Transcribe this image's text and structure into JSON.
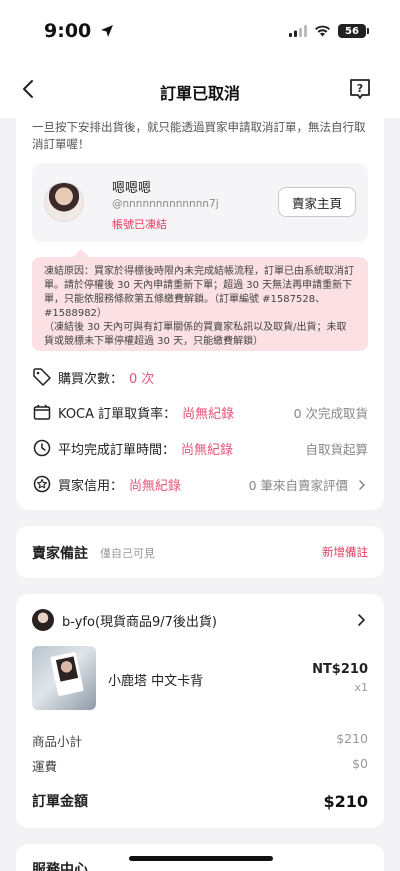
{
  "status_bar": {
    "time": "9:00",
    "battery": "56"
  },
  "nav": {
    "title": "訂單已取消"
  },
  "cancel_notice": "一旦按下安排出貨後，就只能透過買家申請取消訂單，無法自行取消訂單喔！",
  "seller": {
    "name": "嗯嗯嗯",
    "handle": "@nnnnnnnnnnnnn7j",
    "status": "帳號已凍結",
    "home_button": "賣家主頁"
  },
  "freeze_notice": {
    "line1": "凍結原因：買家於得標後時限內未完成結帳流程，訂單已由系統取消訂單。請於停權後 30 天內申請重新下單；超過 30 天無法再申請重新下單，只能依服務條款第五條繳費解鎖。（訂單編號 #1587528、#1588982）",
    "line2": "（凍結後 30 天內可與有訂單關係的買賣家私訊以及取貨/出貨；未取貨或競標未下單停權超過 30 天，只能繳費解鎖）"
  },
  "stats": [
    {
      "label": "購買次數：",
      "value": "0 次",
      "right": "",
      "icon": "tag-icon"
    },
    {
      "label": "KOCA 訂單取貨率：",
      "value": "尚無紀錄",
      "right": "0 次完成取貨",
      "icon": "box-icon"
    },
    {
      "label": "平均完成訂單時間：",
      "value": "尚無紀錄",
      "right": "自取貨起算",
      "icon": "clock-icon"
    },
    {
      "label": "買家信用：",
      "value": "尚無紀錄",
      "right": "0 筆來自賣家評價",
      "icon": "star-badge-icon"
    }
  ],
  "notes": {
    "title": "賣家備註",
    "subtitle": "僅自己可見",
    "add": "新增備註"
  },
  "order": {
    "shop_name": "b-yfo(現貨商品9/7後出貨)",
    "product_name": "小鹿塔 中文卡背",
    "product_price": "NT$210",
    "product_qty": "x1",
    "subtotal_label": "商品小計",
    "subtotal_value": "$210",
    "shipping_label": "運費",
    "shipping_value": "$0",
    "total_label": "訂單金額",
    "total_value": "$210"
  },
  "service": {
    "title": "服務中心"
  },
  "colors": {
    "accent": "#e43d61",
    "freeze_bg": "#fbe1e3",
    "page_bg": "#f3f3f5"
  }
}
